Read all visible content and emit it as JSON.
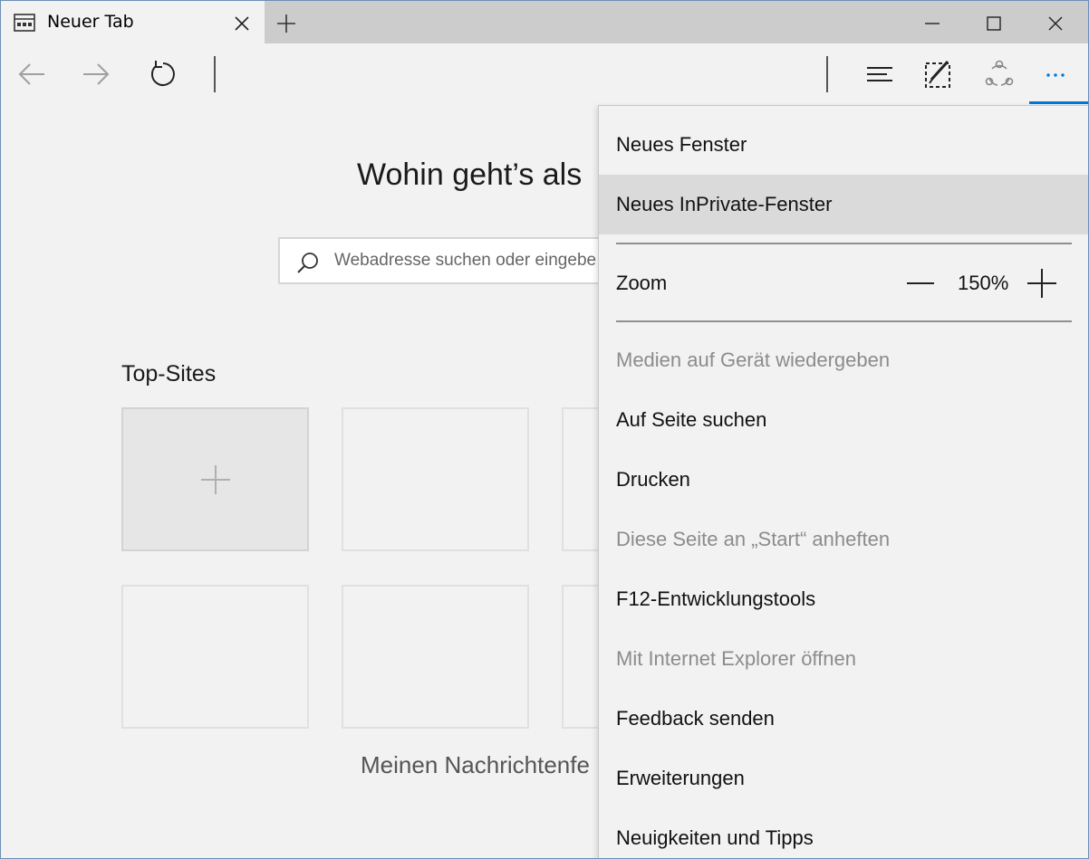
{
  "tab": {
    "title": "Neuer Tab",
    "icon": "tab-page-icon"
  },
  "window_controls": {
    "minimize": "minimize-icon",
    "maximize": "maximize-icon",
    "close": "close-icon"
  },
  "nav": {
    "back": "back-arrow-icon",
    "forward": "forward-arrow-icon",
    "refresh": "refresh-icon",
    "hub": "hub-icon",
    "web_note": "web-note-icon",
    "share": "share-icon",
    "more": "more-dots-icon"
  },
  "content": {
    "heading": "Wohin geht’s als",
    "search": {
      "placeholder": "Webadresse suchen oder eingebe"
    },
    "topsites_title": "Top-Sites",
    "news_link": "Meinen Nachrichtenfe"
  },
  "menu": {
    "new_window": "Neues Fenster",
    "new_inprivate": "Neues InPrivate-Fenster",
    "zoom_label": "Zoom",
    "zoom_value": "150%",
    "items": [
      {
        "label": "Medien auf Gerät wiedergeben",
        "disabled": true
      },
      {
        "label": "Auf Seite suchen",
        "disabled": false
      },
      {
        "label": "Drucken",
        "disabled": false
      },
      {
        "label": "Diese Seite an „Start“ anheften",
        "disabled": true
      },
      {
        "label": "F12-Entwicklungstools",
        "disabled": false
      },
      {
        "label": "Mit Internet Explorer öffnen",
        "disabled": true
      },
      {
        "label": "Feedback senden",
        "disabled": false
      },
      {
        "label": "Erweiterungen",
        "disabled": false
      },
      {
        "label": "Neuigkeiten und Tipps",
        "disabled": false
      }
    ]
  },
  "colors": {
    "accent": "#0078d7",
    "hover": "#dadada",
    "disabled_text": "#8c8c8c"
  }
}
